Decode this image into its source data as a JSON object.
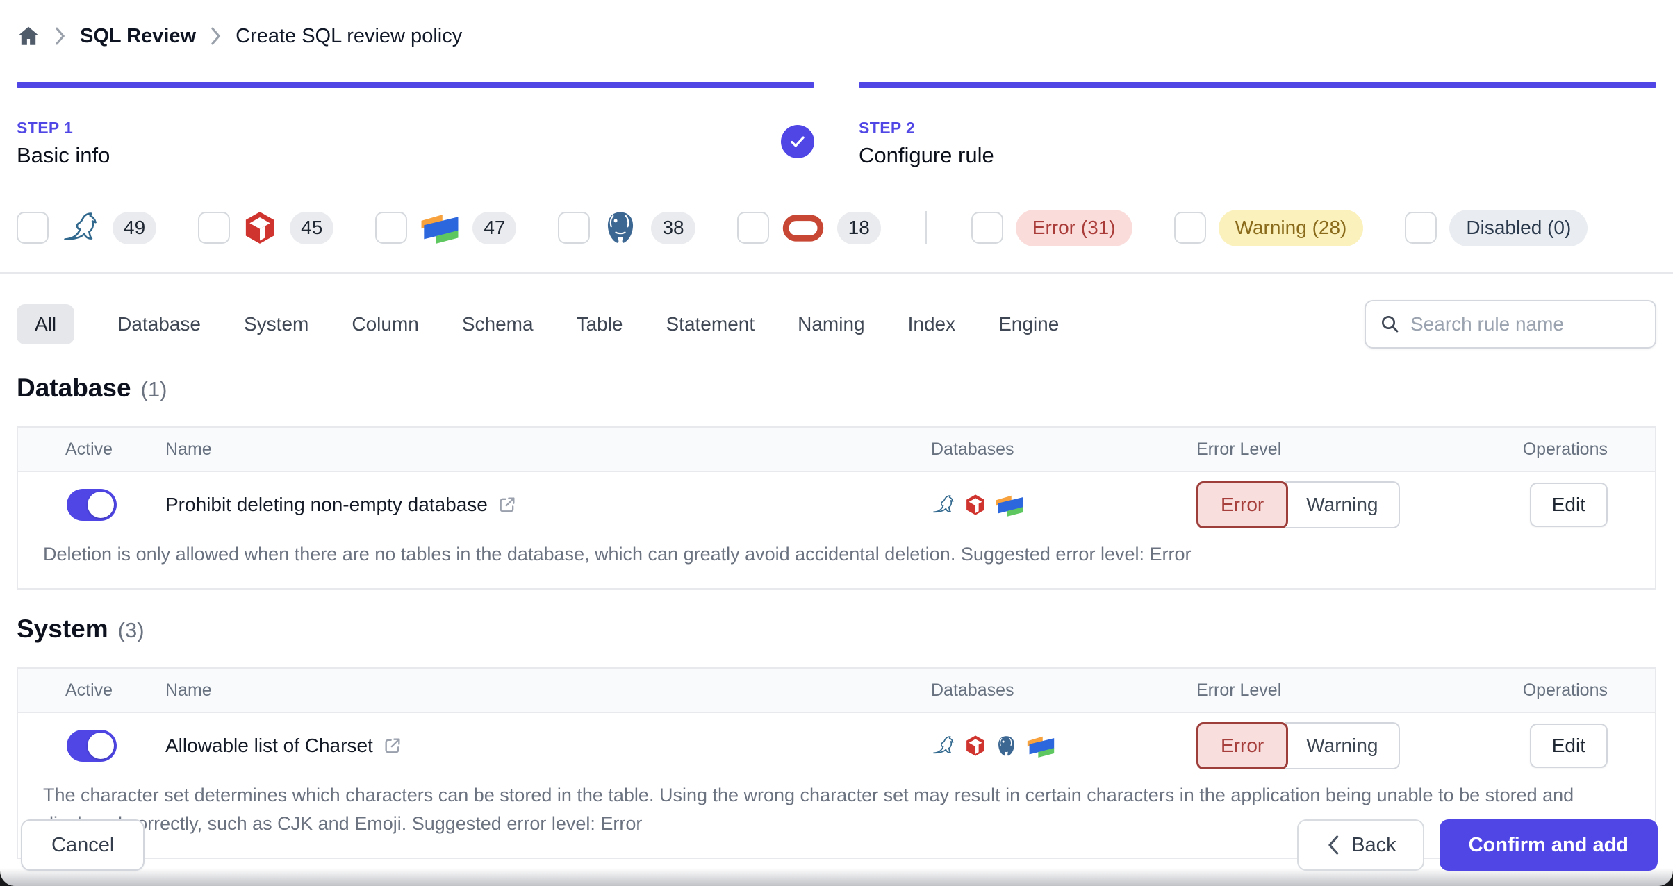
{
  "breadcrumb": {
    "items": [
      "SQL Review",
      "Create SQL review policy"
    ]
  },
  "steps": [
    {
      "label": "STEP 1",
      "title": "Basic info",
      "completed": true
    },
    {
      "label": "STEP 2",
      "title": "Configure rule",
      "completed": false
    }
  ],
  "filters": {
    "engines": [
      {
        "engine": "mysql",
        "count": "49"
      },
      {
        "engine": "tidb",
        "count": "45"
      },
      {
        "engine": "oceanbase",
        "count": "47"
      },
      {
        "engine": "postgresql",
        "count": "38"
      },
      {
        "engine": "oracle",
        "count": "18"
      }
    ],
    "levels": [
      {
        "label": "Error (31)",
        "type": "error"
      },
      {
        "label": "Warning (28)",
        "type": "warning"
      },
      {
        "label": "Disabled (0)",
        "type": "disabled"
      }
    ]
  },
  "tabs": [
    "All",
    "Database",
    "System",
    "Column",
    "Schema",
    "Table",
    "Statement",
    "Naming",
    "Index",
    "Engine"
  ],
  "active_tab": "All",
  "search": {
    "placeholder": "Search rule name"
  },
  "table_labels": {
    "error": "Error",
    "warning": "Warning",
    "edit": "Edit"
  },
  "sections": [
    {
      "title": "Database",
      "count": "(1)",
      "columns": [
        "Active",
        "Name",
        "Databases",
        "Error Level",
        "Operations"
      ],
      "rows": [
        {
          "name": "Prohibit deleting non-empty database",
          "active": true,
          "engines": [
            "mysql",
            "tidb",
            "oceanbase"
          ],
          "error_level": "Error",
          "description": "Deletion is only allowed when there are no tables in the database, which can greatly avoid accidental deletion. Suggested error level: Error"
        }
      ]
    },
    {
      "title": "System",
      "count": "(3)",
      "columns": [
        "Active",
        "Name",
        "Databases",
        "Error Level",
        "Operations"
      ],
      "rows": [
        {
          "name": "Allowable list of Charset",
          "active": true,
          "engines": [
            "mysql",
            "tidb",
            "postgresql",
            "oceanbase"
          ],
          "error_level": "Error",
          "description": "The character set determines which characters can be stored in the table. Using the wrong character set may result in certain characters in the application being unable to be stored and displayed correctly, such as CJK and Emoji. Suggested error level: Error"
        }
      ]
    }
  ],
  "footer": {
    "cancel": "Cancel",
    "back": "Back",
    "confirm": "Confirm and add"
  },
  "colors": {
    "accent": "#4f46e5",
    "error_bg": "#f8dedd",
    "error_text": "#a63f3c",
    "warning_bg": "#faf1bc",
    "warning_text": "#8a6b1c",
    "disabled_bg": "#e9ecf0",
    "disabled_text": "#2b3a4d"
  }
}
